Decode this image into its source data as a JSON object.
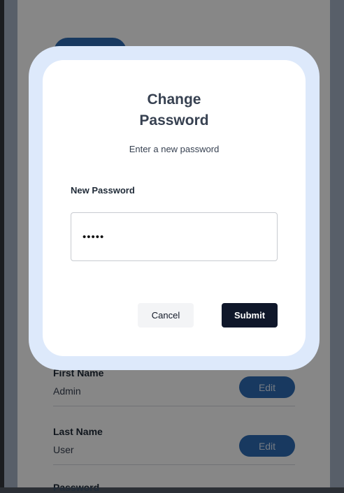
{
  "profile": {
    "fields": [
      {
        "label": "First Name",
        "value": "Admin",
        "edit_label": "Edit"
      },
      {
        "label": "Last Name",
        "value": "User",
        "edit_label": "Edit"
      }
    ],
    "partial_label": "Password"
  },
  "modal": {
    "title": "Change\nPassword",
    "subtitle": "Enter a new password",
    "password_label": "New Password",
    "password_value": "•••••",
    "cancel_label": "Cancel",
    "submit_label": "Submit"
  }
}
